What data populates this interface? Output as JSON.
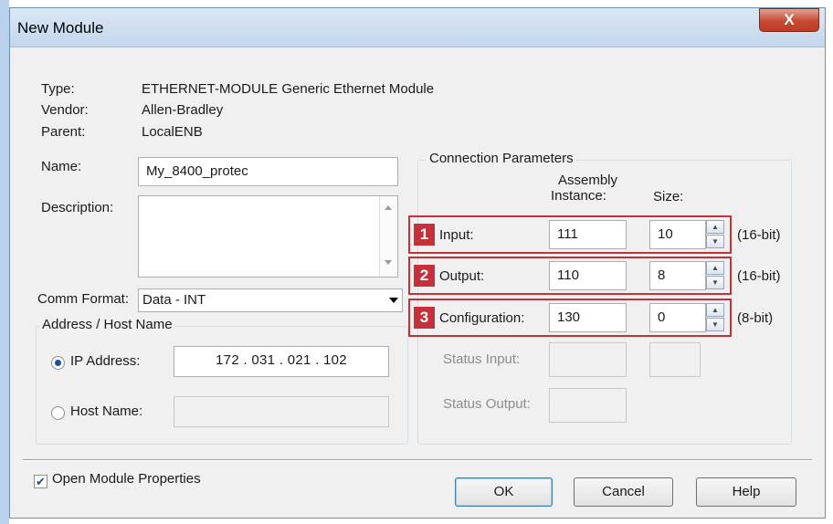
{
  "window": {
    "title": "New Module",
    "close": "X"
  },
  "info": {
    "type_label": "Type:",
    "type_value": "ETHERNET-MODULE Generic Ethernet Module",
    "vendor_label": "Vendor:",
    "vendor_value": "Allen-Bradley",
    "parent_label": "Parent:",
    "parent_value": "LocalENB",
    "name_label": "Name:",
    "name_value": "My_8400_protec",
    "description_label": "Description:",
    "description_value": ""
  },
  "comm_format": {
    "label": "Comm Format:",
    "value": "Data - INT"
  },
  "address": {
    "group_title": "Address / Host Name",
    "ip_label": "IP Address:",
    "ip_value": "172 . 031 . 021 . 102",
    "host_label": "Host Name:",
    "host_value": ""
  },
  "connection": {
    "group_title": "Connection Parameters",
    "col_instance": "Assembly\nInstance:",
    "col_instance_1": "Assembly",
    "col_instance_2": "Instance:",
    "col_size": "Size:",
    "rows": [
      {
        "badge": "1",
        "label": "Input:",
        "instance": "111",
        "size": "10",
        "unit": "(16-bit)"
      },
      {
        "badge": "2",
        "label": "Output:",
        "instance": "110",
        "size": "8",
        "unit": "(16-bit)"
      },
      {
        "badge": "3",
        "label": "Configuration:",
        "instance": "130",
        "size": "0",
        "unit": "(8-bit)"
      }
    ],
    "status_input_label": "Status Input:",
    "status_output_label": "Status Output:"
  },
  "footer": {
    "open_props_label": "Open Module Properties",
    "ok": "OK",
    "cancel": "Cancel",
    "help": "Help"
  },
  "colors": {
    "highlight": "#c5303a",
    "title_bg": "#c3d6ec",
    "window_bg": "#f0f0f0"
  }
}
